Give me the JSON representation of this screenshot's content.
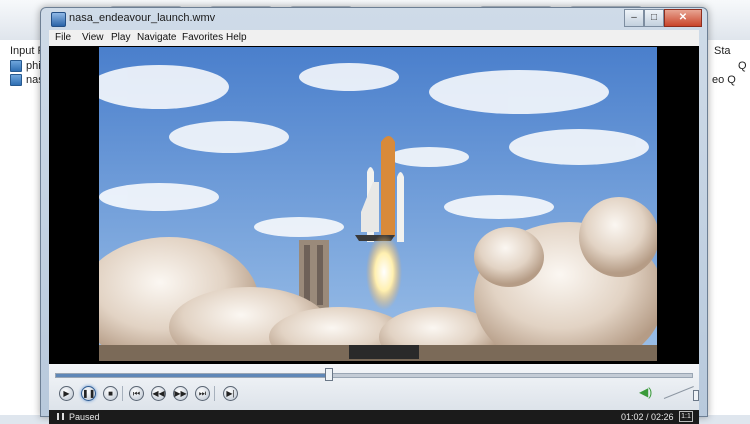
{
  "background": {
    "left_panel": {
      "header": "Input File",
      "files": [
        {
          "name": "philip"
        },
        {
          "name": "nasa_"
        }
      ]
    },
    "right_panel": {
      "header": "Sta",
      "rows": [
        "Q",
        "eo Q"
      ]
    }
  },
  "player": {
    "window_title": "nasa_endeavour_launch.wmv",
    "window_buttons": {
      "minimize": "–",
      "maximize": "□",
      "close": "✕"
    },
    "menu": [
      "File",
      "View",
      "Play",
      "Navigate",
      "Favorites",
      "Help"
    ],
    "playback": {
      "position_fraction": 0.43
    },
    "status": {
      "state": "Paused",
      "time": "01:02 / 02:26",
      "aspect_label": "1:1"
    },
    "controls": [
      {
        "name": "play-button",
        "icon": "play-icon",
        "glyph": "▶"
      },
      {
        "name": "pause-button",
        "icon": "pause-icon",
        "glyph": "❚❚"
      },
      {
        "name": "stop-button",
        "icon": "stop-icon",
        "glyph": "■"
      },
      {
        "name": "previous-frame-button",
        "icon": "previous-icon",
        "glyph": "⏮"
      },
      {
        "name": "rewind-button",
        "icon": "rewind-icon",
        "glyph": "◀◀"
      },
      {
        "name": "fast-forward-button",
        "icon": "fast-forward-icon",
        "glyph": "▶▶"
      },
      {
        "name": "next-frame-button",
        "icon": "next-icon",
        "glyph": "⏭"
      },
      {
        "name": "frame-step-button",
        "icon": "frame-step-icon",
        "glyph": "▶|"
      }
    ],
    "colors": {
      "sky": "#5b8fd6",
      "smoke": "#e6ddd4",
      "flame": "#fff4c8",
      "orbiter": "#f0f0ee"
    }
  }
}
